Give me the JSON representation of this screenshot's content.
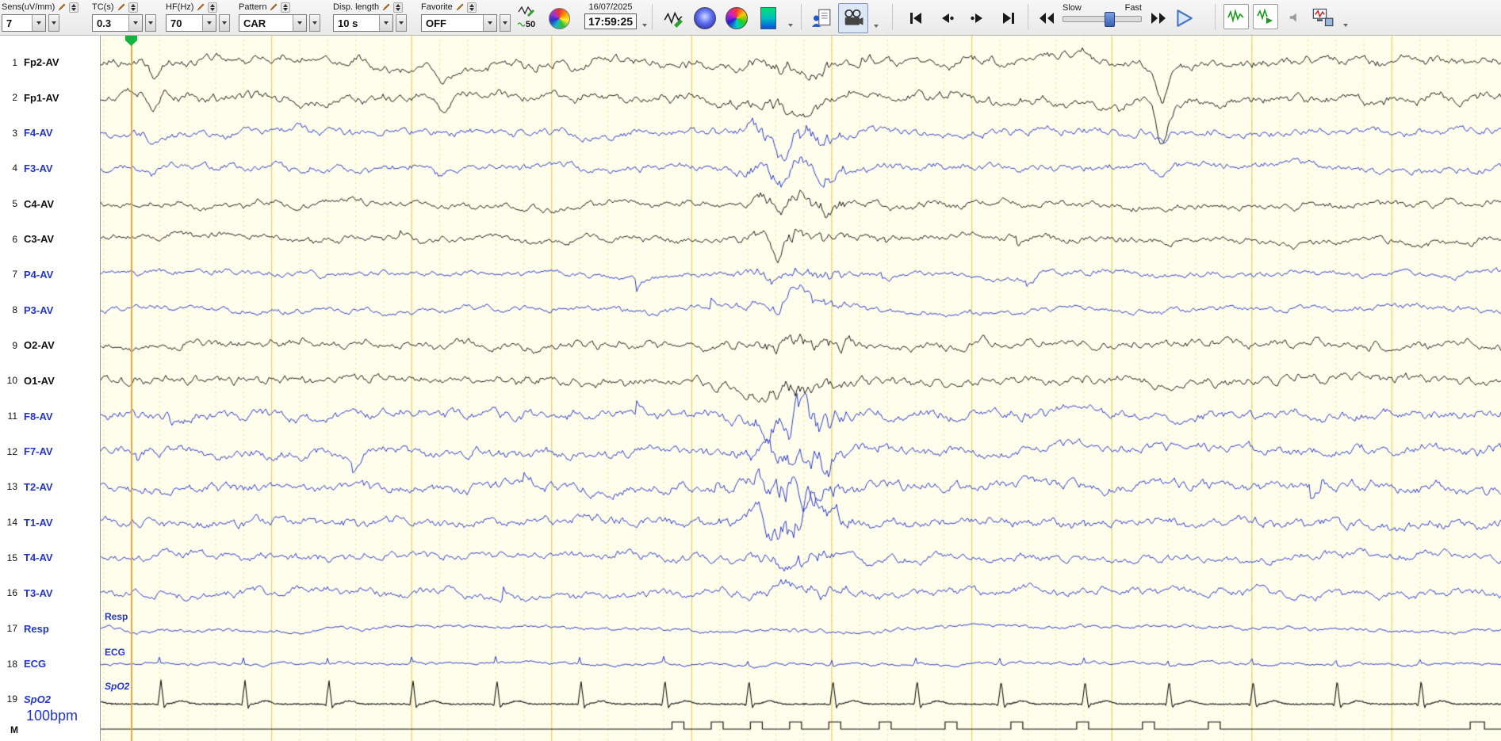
{
  "toolbar": {
    "controls": [
      {
        "label": "Sens(uV/mm)",
        "value": "7"
      },
      {
        "label": "TC(s)",
        "value": "0.3"
      },
      {
        "label": "HF(Hz)",
        "value": "70"
      },
      {
        "label": "Pattern",
        "value": "CAR"
      },
      {
        "label": "Disp. length",
        "value": "10 s"
      },
      {
        "label": "Favorite",
        "value": "OFF"
      }
    ],
    "notch_label": "50",
    "date": "16/07/2025",
    "time": "17:59:25",
    "speed": {
      "slow_label": "Slow",
      "fast_label": "Fast"
    }
  },
  "sidebar": {
    "bottom_marker": "M",
    "heart_rate": "100bpm"
  },
  "trace_labels": {
    "resp": "Resp",
    "ecg": "ECG",
    "spo2": "SpO2"
  },
  "channels": [
    {
      "num": 1,
      "label": "Fp2-AV",
      "color": "black"
    },
    {
      "num": 2,
      "label": "Fp1-AV",
      "color": "black"
    },
    {
      "num": 3,
      "label": "F4-AV",
      "color": "blue"
    },
    {
      "num": 4,
      "label": "F3-AV",
      "color": "blue"
    },
    {
      "num": 5,
      "label": "C4-AV",
      "color": "black"
    },
    {
      "num": 6,
      "label": "C3-AV",
      "color": "black"
    },
    {
      "num": 7,
      "label": "P4-AV",
      "color": "blue"
    },
    {
      "num": 8,
      "label": "P3-AV",
      "color": "blue"
    },
    {
      "num": 9,
      "label": "O2-AV",
      "color": "black"
    },
    {
      "num": 10,
      "label": "O1-AV",
      "color": "black"
    },
    {
      "num": 11,
      "label": "F8-AV",
      "color": "blue"
    },
    {
      "num": 12,
      "label": "F7-AV",
      "color": "blue"
    },
    {
      "num": 13,
      "label": "T2-AV",
      "color": "blue"
    },
    {
      "num": 14,
      "label": "T1-AV",
      "color": "blue"
    },
    {
      "num": 15,
      "label": "T4-AV",
      "color": "blue"
    },
    {
      "num": 16,
      "label": "T3-AV",
      "color": "blue"
    },
    {
      "num": 17,
      "label": "Resp",
      "color": "blue"
    },
    {
      "num": 18,
      "label": "ECG",
      "color": "blue"
    },
    {
      "num": 19,
      "label": "SpO2",
      "color": "blue",
      "italic": true
    }
  ],
  "signal": {
    "display_seconds": 10,
    "heart_rate_bpm": 100
  },
  "colors": {
    "trace_black": "#161616",
    "trace_blue": "#2335c8",
    "paper": "#fffdec",
    "grid_minor": "#ece082",
    "grid_major": "#e0cf52",
    "cursor_orange": "#eda63c",
    "marker_green": "#14b53c"
  }
}
